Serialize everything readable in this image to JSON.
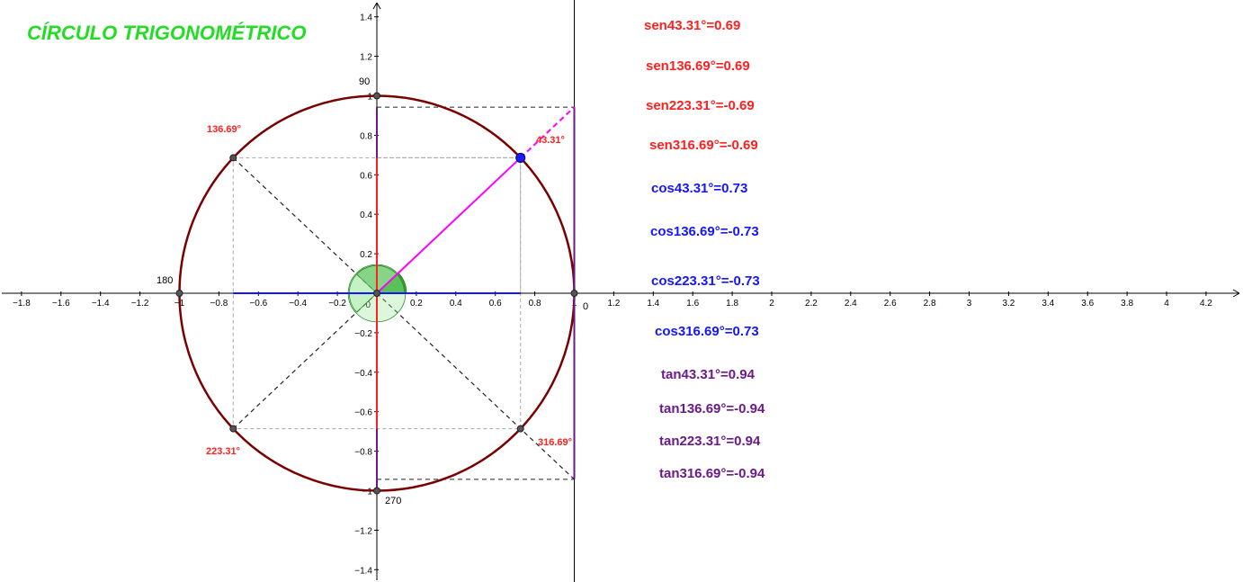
{
  "title": "CÍRCULO TRIGONOMÉTRICO",
  "colors": {
    "title": "#22dd22",
    "circle": "#7a0000",
    "sine": "#ff2020",
    "cosine": "#1515ff",
    "tangent": "#6a1a8a",
    "radius": "#ff00ff",
    "angle_fill": "#2ea82e",
    "angle_fill_light": "#9be89b"
  },
  "axes": {
    "x_ticks": [
      "−1.8",
      "−1.6",
      "−1.4",
      "−1.2",
      "−1",
      "−0.8",
      "−0.6",
      "−0.4",
      "−0.2",
      "0",
      "0.2",
      "0.4",
      "0.6",
      "0.8",
      "1",
      "1.2",
      "1.4",
      "1.6",
      "1.8",
      "2",
      "2.2",
      "2.4",
      "2.6",
      "2.8",
      "3",
      "3.2",
      "3.4",
      "3.6",
      "3.8",
      "4",
      "4.2"
    ],
    "y_ticks": [
      "1.4",
      "1.2",
      "1",
      "0.8",
      "0.6",
      "0.4",
      "0.2",
      "−0.2",
      "−0.4",
      "−0.6",
      "−0.8",
      "−1",
      "−1.2",
      "−1.4"
    ],
    "x_range": [
      -1.9,
      4.35
    ],
    "y_range": [
      -1.45,
      1.48
    ]
  },
  "cardinal_labels": {
    "deg90": "90",
    "deg180": "180",
    "deg270": "270",
    "deg0": "0"
  },
  "angle_labels": {
    "q1": "43.31°",
    "q2": "136.69°",
    "q3": "223.31°",
    "q4": "316.69°"
  },
  "angle_deg": 43.31,
  "unit_circle_radius": 1,
  "tangent_line_x": 1,
  "trig_values": {
    "sin": [
      "sen43.31°=0.69",
      "sen136.69°=0.69",
      "sen223.31°=-0.69",
      "sen316.69°=-0.69"
    ],
    "cos": [
      "cos43.31°=0.73",
      "cos136.69°=-0.73",
      "cos223.31°=-0.73",
      "cos316.69°=0.73"
    ],
    "tan": [
      "tan43.31°=0.94",
      "tan136.69°=-0.94",
      "tan223.31°=0.94",
      "tan316.69°=-0.94"
    ]
  }
}
